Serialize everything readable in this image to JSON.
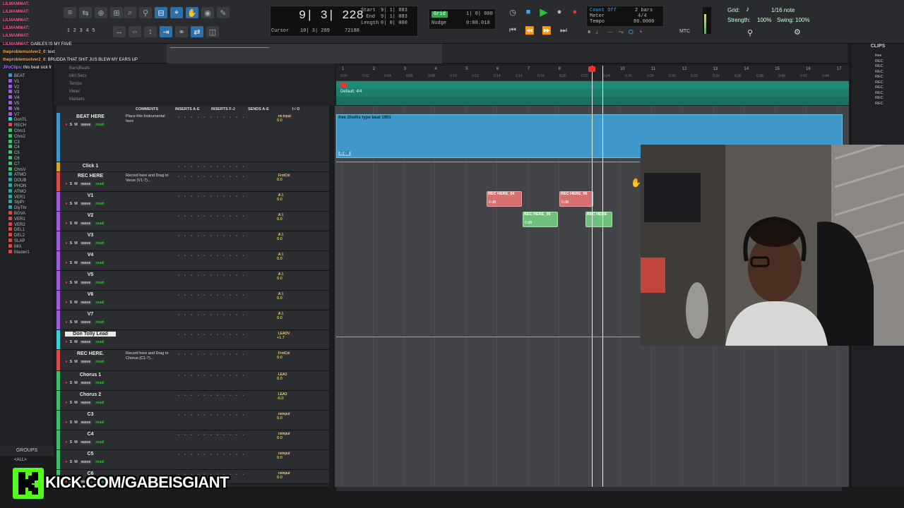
{
  "chat": [
    {
      "user": "LILMAMMAT",
      "msg": ":",
      "color": "#ff5aa0"
    },
    {
      "user": "LILMAMMAT",
      "msg": ":",
      "color": "#ff5aa0"
    },
    {
      "user": "LILMAMMAT",
      "msg": ":",
      "color": "#ff5aa0"
    },
    {
      "user": "LILMAMMAT",
      "msg": ":",
      "color": "#ff5aa0"
    },
    {
      "user": "LILMAMMAT",
      "msg": ":",
      "color": "#ff5aa0"
    },
    {
      "user": "LILMAMMAT",
      "msg": ": GABLES IS MY FAVE",
      "color": "#ff5aa0"
    },
    {
      "user": "theproblemsolver2_0",
      "msg": ": text",
      "color": "#ffa94d"
    },
    {
      "user": "theproblemsolver2_0",
      "msg": ": BRUDDA THAT SHIT JUS BLEW MY EARS UP",
      "color": "#ffa94d"
    },
    {
      "user": "JPoClips",
      "msg": ": this beat sick fr",
      "color": "#9b7dff"
    }
  ],
  "counter": {
    "main": "9| 3| 228",
    "start_label": "Start",
    "start_val": "9| 1| 883",
    "end_label": "End",
    "end_val": "9| 1| 883",
    "length_label": "Length",
    "length_val": "0| 0| 000",
    "cursor_label": "Cursor",
    "cursor_val": "10| 3| 289",
    "samples": "72188"
  },
  "grid": {
    "grid_label": "Grid",
    "grid_val": "1| 0| 000",
    "nudge_label": "Nudge",
    "nudge_val": "0:00.010"
  },
  "meter": {
    "count_off": "Count Off",
    "count_val": "2 bars",
    "meter_label": "Meter",
    "meter_val": "4/4",
    "tempo_label": "Tempo",
    "tempo_val": "86.0000"
  },
  "grid_settings": {
    "grid": "Grid:",
    "note": "1/16 note",
    "strength": "Strength:",
    "strength_val": "100%",
    "swing": "Swing:",
    "swing_val": "100%",
    "mtc": "MTC"
  },
  "left_list": [
    "BEAT",
    "V1",
    "V2",
    "V3",
    "V4",
    "V5",
    "V6",
    "V7",
    "DonTL",
    "RECH",
    "Chrs1",
    "Chrs2",
    "C3",
    "C4",
    "C5",
    "C6",
    "C7",
    "ChrsV",
    "ATMO",
    "DOUB",
    "PHON",
    "ATMO",
    "VER1",
    "SlpPr",
    "DlyThr",
    "BGVA",
    "VER1",
    "VER2",
    "DEL1",
    "DEL2",
    "SLAP",
    "MIX",
    "Master1"
  ],
  "groups": "GROUPS",
  "all_group": "<ALL>",
  "rulers": [
    "Bars|Beats",
    "Min:Secs",
    "Tempo",
    "Meter",
    "Markers"
  ],
  "ruler_bars": [
    "1",
    "2",
    "3",
    "4",
    "5",
    "6",
    "7",
    "8",
    "9",
    "10",
    "11",
    "12",
    "13",
    "14",
    "15",
    "16",
    "17"
  ],
  "ruler_times": [
    "0:00",
    "0:02",
    "0:04",
    "0:06",
    "0:08",
    "0:10",
    "0:12",
    "0:14",
    "0:16",
    "0:18",
    "0:20",
    "0:22",
    "0:24",
    "0:26",
    "0:28",
    "0:30",
    "0:32",
    "0:34",
    "0:36",
    "0:38",
    "0:40",
    "0:42",
    "0:44"
  ],
  "meter_default": "Default: 4/4",
  "col_headers": {
    "comments": "COMMENTS",
    "inserts_ae": "INSERTS A-E",
    "inserts_fj": "INSERTS F-J",
    "sends": "SENDS A-E",
    "io": "I / O"
  },
  "tracks": [
    {
      "name": "BEAT HERE",
      "comment": "Place this Instrumental here",
      "color": "#3f98c9",
      "input": "no input",
      "vol": "0.0",
      "pan": "100 100"
    },
    {
      "name": "Click 1",
      "comment": "",
      "color": "#d8a23a",
      "input": "",
      "vol": "",
      "pan": ""
    },
    {
      "name": "REC HERE",
      "comment": "Record here and Drag to Verse (V1-7)...",
      "color": "#d94a4a",
      "input": "FrntCnl",
      "vol": "0.0",
      "pan": "0"
    },
    {
      "name": "V1",
      "comment": "",
      "color": "#a15ad9",
      "input": "A 1",
      "vol": "0.0",
      "pan": "0"
    },
    {
      "name": "V2",
      "comment": "",
      "color": "#a15ad9",
      "input": "A 1",
      "vol": "0.0",
      "pan": "0"
    },
    {
      "name": "V3",
      "comment": "",
      "color": "#a15ad9",
      "input": "A 1",
      "vol": "0.0",
      "pan": "0"
    },
    {
      "name": "V4",
      "comment": "",
      "color": "#a15ad9",
      "input": "A 1",
      "vol": "0.0",
      "pan": "0"
    },
    {
      "name": "V5",
      "comment": "",
      "color": "#a15ad9",
      "input": "A 1",
      "vol": "0.0",
      "pan": "0"
    },
    {
      "name": "V6",
      "comment": "",
      "color": "#a15ad9",
      "input": "A 1",
      "vol": "0.0",
      "pan": "0"
    },
    {
      "name": "V7",
      "comment": "",
      "color": "#a15ad9",
      "input": "A 1",
      "vol": "0.0",
      "pan": "0"
    },
    {
      "name": "Don Tolly Lead",
      "comment": "",
      "color": "#39d0d8",
      "input": "LEADV",
      "vol": "+1.7",
      "pan": "P P"
    },
    {
      "name": "REC HERE.",
      "comment": "Record here and Drag to Chorus (C1-7)...",
      "color": "#d94a4a",
      "input": "FrntCnl",
      "vol": "0.0",
      "pan": "0"
    },
    {
      "name": "Chorus 1",
      "comment": "",
      "color": "#3fbf6e",
      "input": "LEA3",
      "vol": "0.0",
      "pan": "P P"
    },
    {
      "name": "Chorus 2",
      "comment": "",
      "color": "#3fbf6e",
      "input": "LEA3",
      "vol": "-6.0",
      "pan": "P P"
    },
    {
      "name": "C3",
      "comment": "",
      "color": "#3fbf6e",
      "input": "noinput",
      "vol": "0.0",
      "pan": "0"
    },
    {
      "name": "C4",
      "comment": "",
      "color": "#3fbf6e",
      "input": "noinput",
      "vol": "0.0",
      "pan": "0"
    },
    {
      "name": "C5",
      "comment": "",
      "color": "#3fbf6e",
      "input": "noinput",
      "vol": "0.0",
      "pan": "0"
    },
    {
      "name": "C6",
      "comment": "",
      "color": "#3fbf6e",
      "input": "noinput",
      "vol": "0.0",
      "pan": "0"
    }
  ],
  "beat_region": {
    "title": "free 2hollis type beat 1901",
    "gain": "0 dB"
  },
  "clips": [
    {
      "title": "REC HERE_04",
      "gain": "0 dB",
      "kind": "red"
    },
    {
      "title": "REC HERE_06",
      "gain": "0 dB",
      "kind": "red"
    },
    {
      "title": "REC HERE_05",
      "gain": "0 dB",
      "kind": "green"
    },
    {
      "title": "REC HERE",
      "gain": "0 dB",
      "kind": "green"
    }
  ],
  "clips_panel": {
    "title": "CLIPS",
    "entries": [
      "free",
      "REC",
      "REC",
      "REC",
      "REC",
      "REC",
      "REC",
      "REC",
      "REC",
      "REC"
    ]
  },
  "kick": {
    "text": "KICK.COM/GABEISGIANT"
  },
  "colors": {
    "accent": "#2f6fa8",
    "region_blue": "#3f98c9",
    "kick_green": "#53fc18",
    "play_green": "#2fc03a"
  }
}
